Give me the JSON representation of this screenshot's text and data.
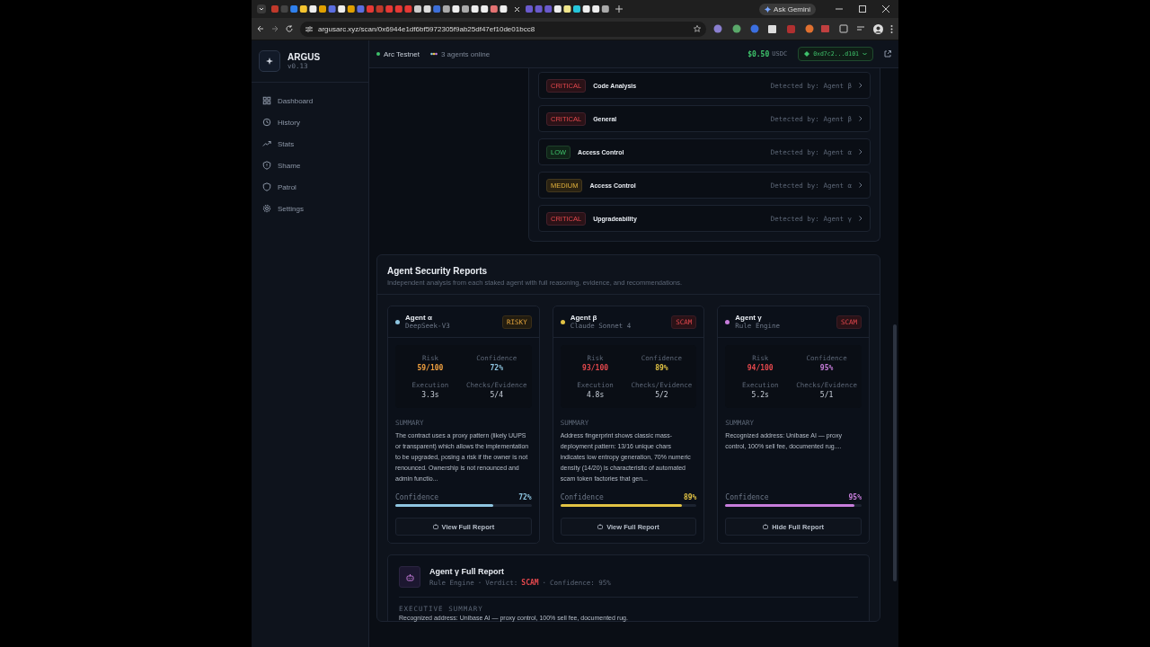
{
  "browser": {
    "ask_button": "Ask Gemini",
    "url": "argusarc.xyz/scan/0x6944e1df6bf5972305f9ab25df47ef10de01bcc8"
  },
  "brand": {
    "name": "ARGUS",
    "version": "v0.13"
  },
  "sidebar": {
    "items": [
      {
        "label": "Dashboard",
        "kind": "grid",
        "selected": false
      },
      {
        "label": "History",
        "kind": "clock",
        "selected": false
      },
      {
        "label": "Stats",
        "kind": "trend",
        "selected": false
      },
      {
        "label": "Shame",
        "kind": "alert",
        "selected": false
      },
      {
        "label": "Patrol",
        "kind": "shield",
        "selected": false
      },
      {
        "label": "Settings",
        "kind": "gear",
        "selected": false
      }
    ]
  },
  "header": {
    "network": "Arc Testnet",
    "agents": "3 agents online",
    "balance": "$0.50",
    "currency": "USDC",
    "wallet": "0xd7c2...d101"
  },
  "findings": [
    {
      "severity": "CRITICAL",
      "kind": "critical",
      "title": "Code Analysis",
      "detected": "Detected by: Agent β"
    },
    {
      "severity": "CRITICAL",
      "kind": "critical",
      "title": "General",
      "detected": "Detected by: Agent β"
    },
    {
      "severity": "LOW",
      "kind": "low",
      "title": "Access Control",
      "detected": "Detected by: Agent α"
    },
    {
      "severity": "MEDIUM",
      "kind": "medium",
      "title": "Access Control",
      "detected": "Detected by: Agent α"
    },
    {
      "severity": "CRITICAL",
      "kind": "critical",
      "title": "Upgradeability",
      "detected": "Detected by: Agent γ"
    }
  ],
  "reports": {
    "title": "Agent Security Reports",
    "subtitle": "Independent analysis from each staked agent with full reasoning, evidence, and recommendations.",
    "agents": [
      {
        "name": "Agent α",
        "model": "DeepSeek-V3",
        "color": "#8ec5e0",
        "verdict": "RISKY",
        "kind": "risky",
        "stats": [
          {
            "label": "Risk",
            "value": "59/100",
            "kind": "warn"
          },
          {
            "label": "Confidence",
            "value": "72%",
            "kind": "agent"
          },
          {
            "label": "Execution",
            "value": "3.3s",
            "kind": "plain"
          },
          {
            "label": "Checks/Evidence",
            "value": "5/4",
            "kind": "plain"
          }
        ],
        "summary_label": "SUMMARY",
        "summary": "The contract uses a proxy pattern (likely UUPS or transparent) which allows the implementation to be upgraded, posing a risk if the owner is not renounced. Ownership is not renounced and admin functio...",
        "confidence_label": "Confidence",
        "confidence": "72%",
        "level": 0.72,
        "button": "View Full Report"
      },
      {
        "name": "Agent β",
        "model": "Claude Sonnet 4",
        "color": "#e2c344",
        "verdict": "SCAM",
        "kind": "scam",
        "stats": [
          {
            "label": "Risk",
            "value": "93/100",
            "kind": "danger"
          },
          {
            "label": "Confidence",
            "value": "89%",
            "kind": "agent"
          },
          {
            "label": "Execution",
            "value": "4.8s",
            "kind": "plain"
          },
          {
            "label": "Checks/Evidence",
            "value": "5/2",
            "kind": "plain"
          }
        ],
        "summary_label": "SUMMARY",
        "summary": "Address fingerprint shows classic mass-deployment pattern: 13/16 unique chars indicates low entropy generation, 70% numeric density (14/20) is characteristic of automated scam token factories that gen...",
        "confidence_label": "Confidence",
        "confidence": "89%",
        "level": 0.89,
        "button": "View Full Report"
      },
      {
        "name": "Agent γ",
        "model": "Rule Engine",
        "color": "#c77ddb",
        "verdict": "SCAM",
        "kind": "scam",
        "stats": [
          {
            "label": "Risk",
            "value": "94/100",
            "kind": "danger"
          },
          {
            "label": "Confidence",
            "value": "95%",
            "kind": "agent"
          },
          {
            "label": "Execution",
            "value": "5.2s",
            "kind": "plain"
          },
          {
            "label": "Checks/Evidence",
            "value": "5/1",
            "kind": "plain"
          }
        ],
        "summary_label": "SUMMARY",
        "summary": "Recognized address: Unibase AI — proxy control, 100% sell fee, documented rug....",
        "confidence_label": "Confidence",
        "confidence": "95%",
        "level": 0.95,
        "button": "Hide Full Report"
      }
    ]
  },
  "full_report": {
    "title": "Agent γ Full Report",
    "engine": "Rule Engine",
    "separator": "·",
    "verdict_label": "Verdict:",
    "verdict": "SCAM",
    "confidence": "Confidence: 95%",
    "section_label": "EXECUTIVE SUMMARY",
    "text": "Recognized address: Unibase AI — proxy control, 100% sell fee, documented rug."
  }
}
